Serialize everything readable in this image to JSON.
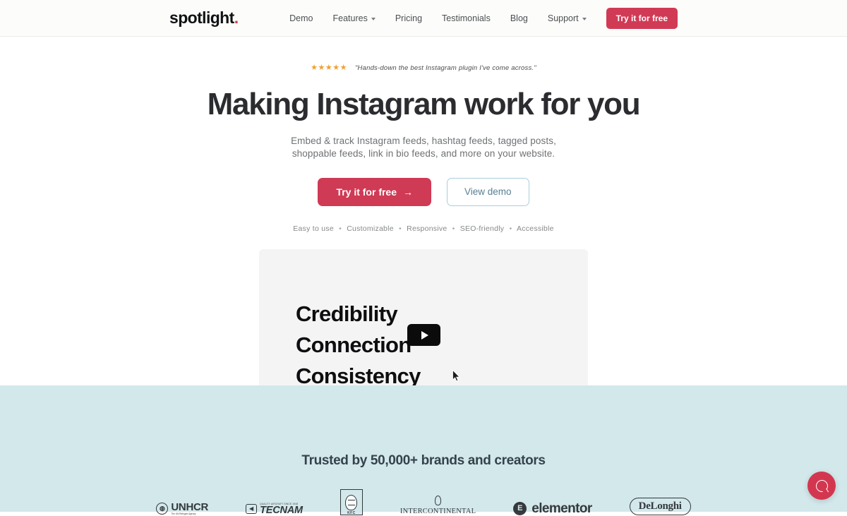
{
  "header": {
    "logo_text": "spotlight",
    "logo_dot": ".",
    "nav_items": [
      {
        "label": "Demo",
        "has_caret": false
      },
      {
        "label": "Features",
        "has_caret": true
      },
      {
        "label": "Pricing",
        "has_caret": false
      },
      {
        "label": "Testimonials",
        "has_caret": false
      },
      {
        "label": "Blog",
        "has_caret": false
      },
      {
        "label": "Support",
        "has_caret": true
      }
    ],
    "cta_label": "Try it for free",
    "cta_color": "#d13a55"
  },
  "hero": {
    "stars": "★★★★★",
    "star_color": "#f0a030",
    "quote": "\"Hands-down the best Instagram plugin I've come across.\"",
    "title": "Making Instagram work for you",
    "subtitle_line1": "Embed & track Instagram feeds, hashtag feeds, tagged posts,",
    "subtitle_line2": "shoppable feeds, link in bio feeds, and more on your website.",
    "primary_cta": "Try it for free",
    "primary_cta_arrow": "→",
    "secondary_cta": "View demo",
    "features": [
      "Easy to use",
      "Customizable",
      "Responsive",
      "SEO-friendly",
      "Accessible"
    ],
    "feature_separator": "•"
  },
  "video": {
    "line1": "Credibility",
    "line2": "Connection",
    "line3": "Consistency",
    "background": "#f4f4f5",
    "play_button_label": "Play video"
  },
  "trusted": {
    "title": "Trusted by 50,000+ brands and creators",
    "background": "#d3e8eb",
    "brands": [
      {
        "name": "UNHCR",
        "sub": "The UN Refugee Agency"
      },
      {
        "name": "TECNAM",
        "sub": "QUALITY AIRCRAFT SINCE 1948"
      },
      {
        "name": "KFC",
        "sub": ""
      },
      {
        "name": "INTERCONTINENTAL",
        "sub": ""
      },
      {
        "name": "elementor",
        "sub": ""
      },
      {
        "name": "DeLonghi",
        "sub": ""
      }
    ]
  },
  "chat": {
    "label": "Open chat",
    "color": "#d3374f"
  }
}
